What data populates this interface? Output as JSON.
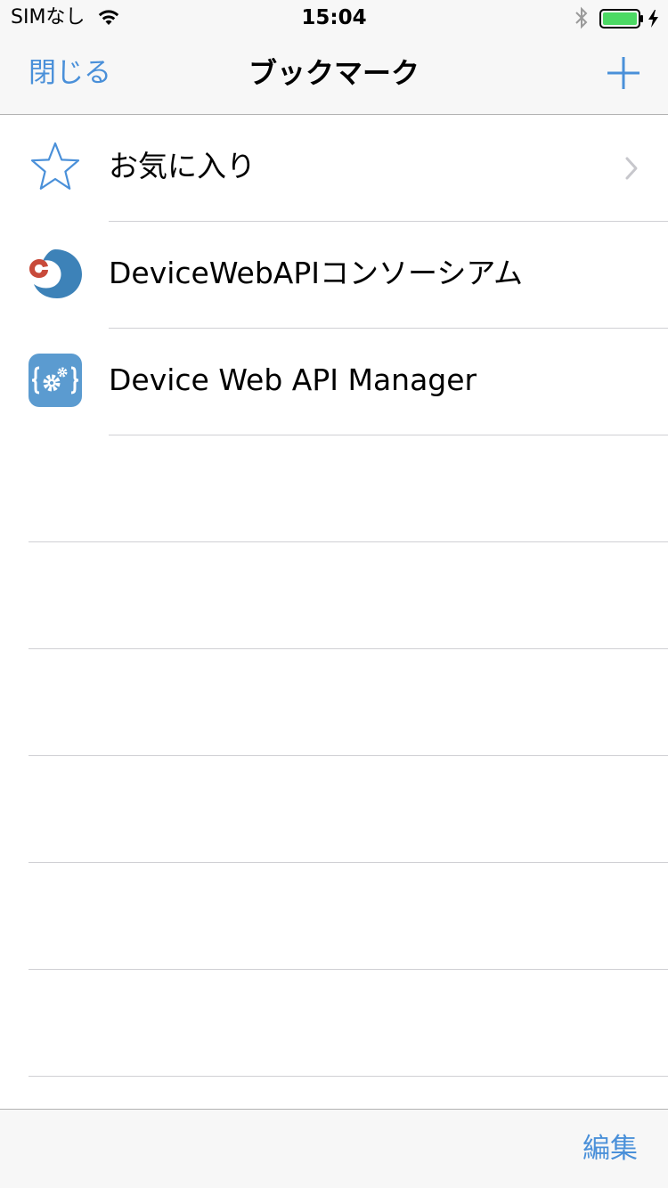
{
  "status_bar": {
    "carrier": "SIMなし",
    "time": "15:04",
    "icons": [
      "wifi-icon",
      "bluetooth-icon",
      "battery-charging-icon"
    ],
    "battery_color": "#4cd964"
  },
  "nav_bar": {
    "close_label": "閉じる",
    "title": "ブックマーク",
    "add_icon": "plus-icon"
  },
  "bookmarks": [
    {
      "label": "お気に入り",
      "icon": "star-icon",
      "has_disclosure": true
    },
    {
      "label": "DeviceWebAPIコンソーシアム",
      "icon": "consortium-logo-icon",
      "has_disclosure": false
    },
    {
      "label": "Device Web API Manager",
      "icon": "gear-braces-app-icon",
      "has_disclosure": false
    }
  ],
  "toolbar": {
    "edit_label": "編集"
  },
  "colors": {
    "accent": "#4a90d9",
    "separator": "#d0d0d4",
    "bar_background": "#f7f7f7"
  }
}
